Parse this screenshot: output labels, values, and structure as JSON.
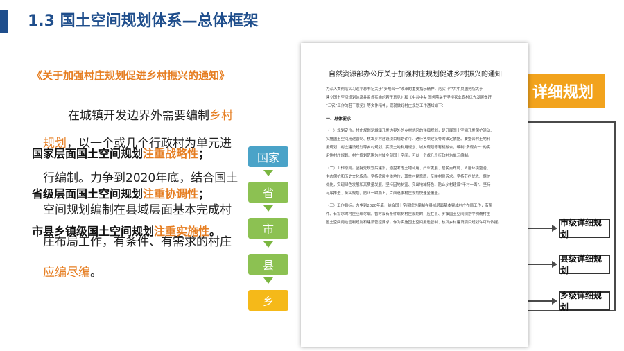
{
  "title": "1.3 国土空间规划体系—总体框架",
  "notice": "《关于加强村庄规划促进乡村振兴的通知》",
  "paragraph": {
    "l1_pre": "在城镇开发边界外需要编制",
    "l1_orange": "乡村",
    "l2_orange": "规划",
    "l2_rest": "，以一个或几个行政村为单元进",
    "l3": "行编制。力争到2020年底，结合国土",
    "l4": "空间规划编制在县域层面基本完成村",
    "l5": "庄布局工作，有条件、有需求的村庄",
    "l6_orange": "应编尽编",
    "l6_end": "。"
  },
  "levels": [
    {
      "label": "国家层面国土空间规划",
      "emphasis": "注重战略性",
      "end": "；"
    },
    {
      "label": "省级层面国土空间规划",
      "emphasis": "注重协调性",
      "end": "；"
    },
    {
      "label": "市县乡镇级国土空间规划",
      "emphasis": "注重实施性",
      "end": "。"
    }
  ],
  "chain": [
    {
      "label": "国家",
      "color": "#4aa3c8"
    },
    {
      "label": "省",
      "color": "#8cc152"
    },
    {
      "label": "市",
      "color": "#8cc152"
    },
    {
      "label": "县",
      "color": "#8cc152"
    },
    {
      "label": "乡",
      "color": "#f5b919"
    }
  ],
  "document": {
    "title": "自然资源部办公厅关于加强村庄规划促进乡村振兴的通知",
    "intro": [
      "为深入贯彻落实习近平总书记关于“多规合一”改革的重要指示精神，落实《中共中央国务院关于",
      "建立国土空间规划体系并监督实施的若干意见》和《中共中央 国务院关于坚持农业农村优先发展做好",
      "“三农”工作的若干意见》等文件精神，现就做好村庄规划工作通知如下："
    ],
    "section1": "一、总体要求",
    "body": [
      "（一）规划定位。村庄规划是城镇开发边界外的乡村地区的详细规划，是开展国土空间开发保护活动、",
      "实施国土空间用途管制、核发乡村建设项目规划许可、进行各项建设等的法定依据。要整合村土地利",
      "用规划、村庄建设规划等乡村规划，实现土地利用规划、城乡规划等有机融合，编制“多规合一”的实",
      "用性村庄规划。村庄规划范围为村域全部国土空间，可以一个或几个行政村为单元编制。",
      "（二）工作原则。坚持先规划后建设，通盘考虑土地利用、产业发展、居民点布局、人居环境整治、",
      "生态保护和历史文化传承。坚持农民主体地位，尊重村民意愿，反映村民诉求。坚持节约优先、保护",
      "优先，实现绿色发展和高质量发展。坚持因地制宜、突出地域特色，防止乡村建设“千村一面”。坚持",
      "有序推进、务实规划，防止一哄而上，片面追求村庄规划快速全覆盖。",
      "（三）工作目标。力争到2020年底，结合国土空间规划编制在县域层面基本完成村庄布局工作，有条",
      "件、有需求的村庄应编尽编。暂时没有条件编制村庄规划的，应在县、乡镇国土空间规划中明确村庄",
      "国土空间用途管制规则和建设管控要求，作为实施国土空间用途管制、核发乡村建设项目规划许可的依据。"
    ]
  },
  "detail_header": "详细规划",
  "detail_plans": [
    "市级详细规划",
    "县级详细规划",
    "乡级详细规划"
  ]
}
